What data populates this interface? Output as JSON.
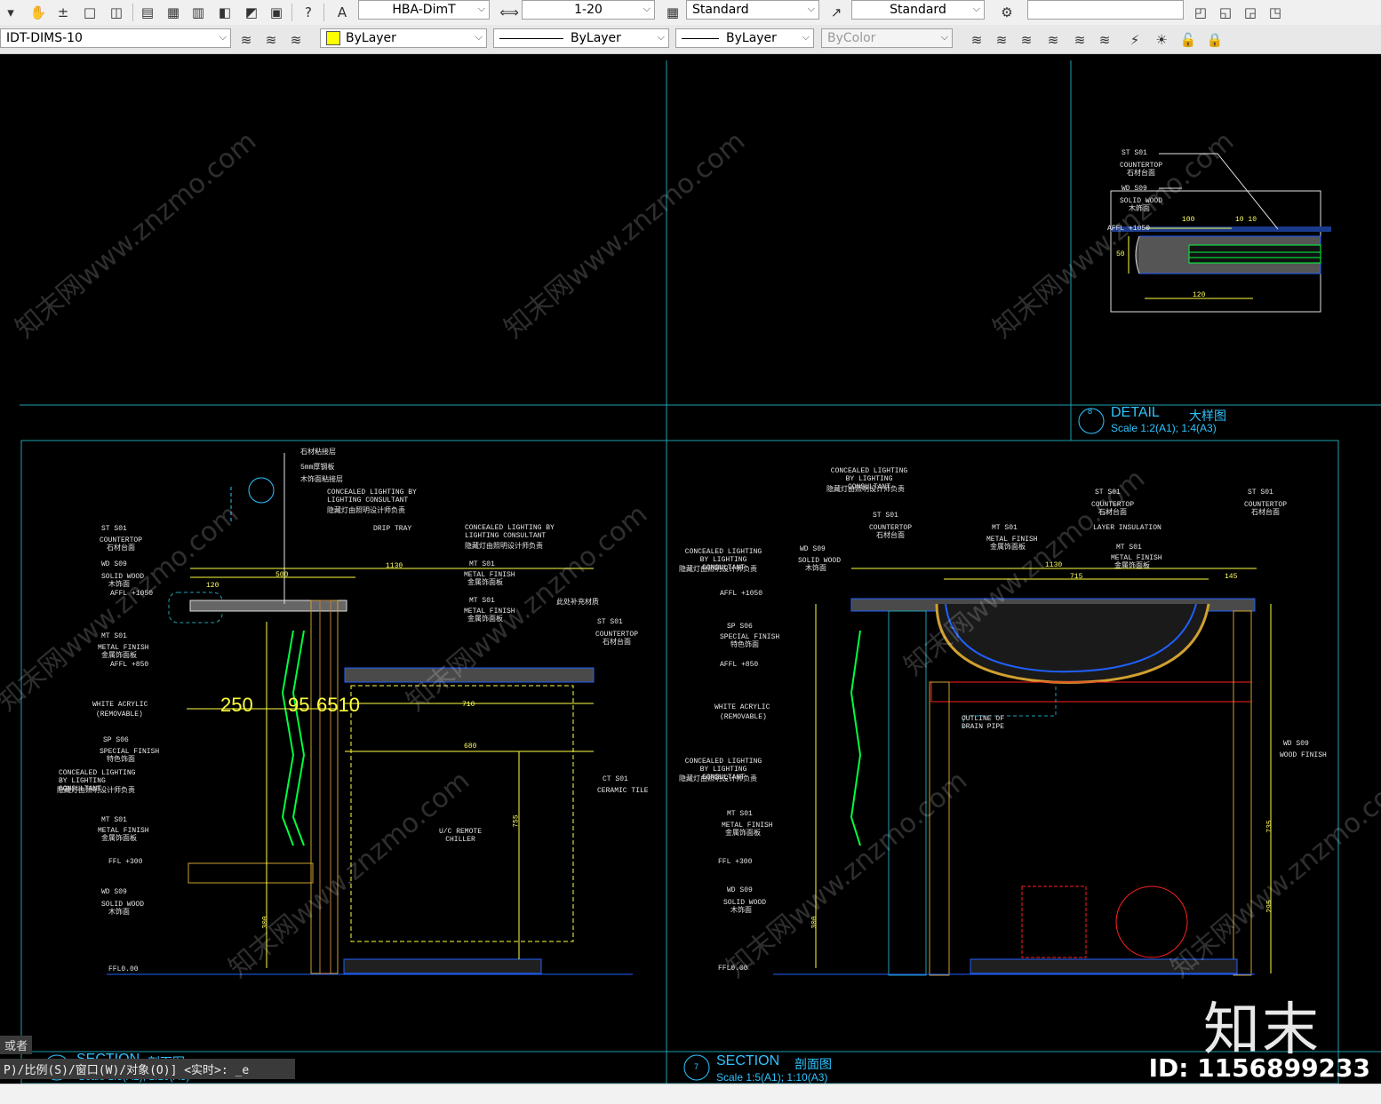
{
  "toolbar1": {
    "dimstyle": "HBA-DimT",
    "scale": "1-20",
    "tablestyle": "Standard",
    "mleaderstyle": "Standard",
    "blank_combo": ""
  },
  "toolbar2": {
    "layer": "IDT-DIMS-10",
    "color": "ByLayer",
    "linetype": "ByLayer",
    "lineweight": "ByLayer",
    "plotstyle": "ByColor"
  },
  "colors": {
    "accent_cyan": "#2ec4ff",
    "yellow": "#ffff40",
    "green": "#00ff40",
    "red": "#ff2020",
    "frame": "#1fa0b0"
  },
  "drawing": {
    "detail_title": "DETAIL",
    "detail_title_cn": "大样图",
    "detail_scale": "Scale 1:2(A1); 1:4(A3)",
    "detail_num": "8",
    "detail_labels": {
      "st_code": "ST",
      "st_num": "S01",
      "countertop": "COUNTERTOP",
      "countertop_cn": "石材台面",
      "wd_code": "WD",
      "wd_num": "S09",
      "solid_wood": "SOLID WOOD",
      "solid_wood_cn": "木饰面",
      "affl": "AFFL +1050",
      "dim_100": "100",
      "dim_10_10": "10 10",
      "dim_120": "120",
      "dim_50": "50"
    },
    "left_section": {
      "title": "SECTION",
      "title_cn": "剖面图",
      "scale": "Scale 1:5(A1); 1:10(A3)",
      "num": "6",
      "note1": "石材粘接层",
      "note2": "5mm厚钢板",
      "note3": "木饰面粘接层",
      "lighting": "CONCEALED LIGHTING BY LIGHTING CONSULTANT",
      "lighting_cn": "隐藏灯由照明设计师负责",
      "drip_tray": "DRIP TRAY",
      "st": "ST",
      "s01": "S01",
      "countertop": "COUNTERTOP",
      "countertop_cn": "石材台面",
      "wd": "WD",
      "s09": "S09",
      "solid_wood": "SOLID WOOD",
      "solid_wood_cn": "木饰面",
      "affl1050": "AFFL +1050",
      "mt": "MT",
      "metal_finish": "METAL FINISH",
      "metal_finish_cn": "金属饰面板",
      "affl850": "AFFL +850",
      "white_acrylic": "WHITE ACRYLIC",
      "removable": "(REMOVABLE)",
      "sp": "SP",
      "s06": "S06",
      "special_finish": "SPECIAL FINISH",
      "special_finish_cn": "特色饰面",
      "ffl300": "FFL +300",
      "ffl0": "FFL0.00",
      "ct": "CT",
      "ceramic_tile": "CERAMIC TILE",
      "note_cn": "此处补充材质",
      "chiller": "U/C REMOTE CHILLER",
      "dim_1130": "1130",
      "dim_500": "500",
      "dim_120": "120",
      "dim_710": "710",
      "dim_680": "680",
      "dim_755": "755",
      "dim_300": "300",
      "dim_big_250": "250",
      "dim_big_95": "95",
      "dim_big_6510": "6510"
    },
    "right_section": {
      "title": "SECTION",
      "title_cn": "剖面图",
      "scale": "Scale 1:5(A1); 1:10(A3)",
      "num": "7",
      "lighting": "CONCEALED LIGHTING BY LIGHTING CONSULTANT",
      "lighting_cn": "隐藏灯由照明设计师负责",
      "st": "ST",
      "s01": "S01",
      "countertop": "COUNTERTOP",
      "countertop_cn": "石材台面",
      "mt": "MT",
      "metal_finish": "METAL FINISH",
      "metal_finish_cn": "金属饰面板",
      "layer_insulation": "LAYER INSULATION",
      "wd": "WD",
      "s09": "S09",
      "solid_wood": "SOLID WOOD",
      "solid_wood_cn": "木饰面",
      "wood_finish": "WOOD FINISH",
      "affl1050": "AFFL +1050",
      "sp": "SP",
      "s06": "S06",
      "special_finish": "SPECIAL FINISH",
      "special_finish_cn": "特色饰面",
      "affl850": "AFFL +850",
      "white_acrylic": "WHITE ACRYLIC",
      "removable": "(REMOVABLE)",
      "drain": "OUTLINE OF DRAIN PIPE",
      "ffl300": "FFL +300",
      "ffl0": "FFL0.00",
      "dim_1130": "1130",
      "dim_715": "715",
      "dim_145": "145",
      "dim_300": "300",
      "dim_735": "735",
      "dim_295": "295"
    }
  },
  "watermark": {
    "text": "知末网www.znzmo.com",
    "logo": "知末",
    "id": "ID: 1156899233"
  },
  "command": {
    "line1": "或者",
    "line2": "P)/比例(S)/窗口(W)/对象(O)] <实时>: _e"
  }
}
